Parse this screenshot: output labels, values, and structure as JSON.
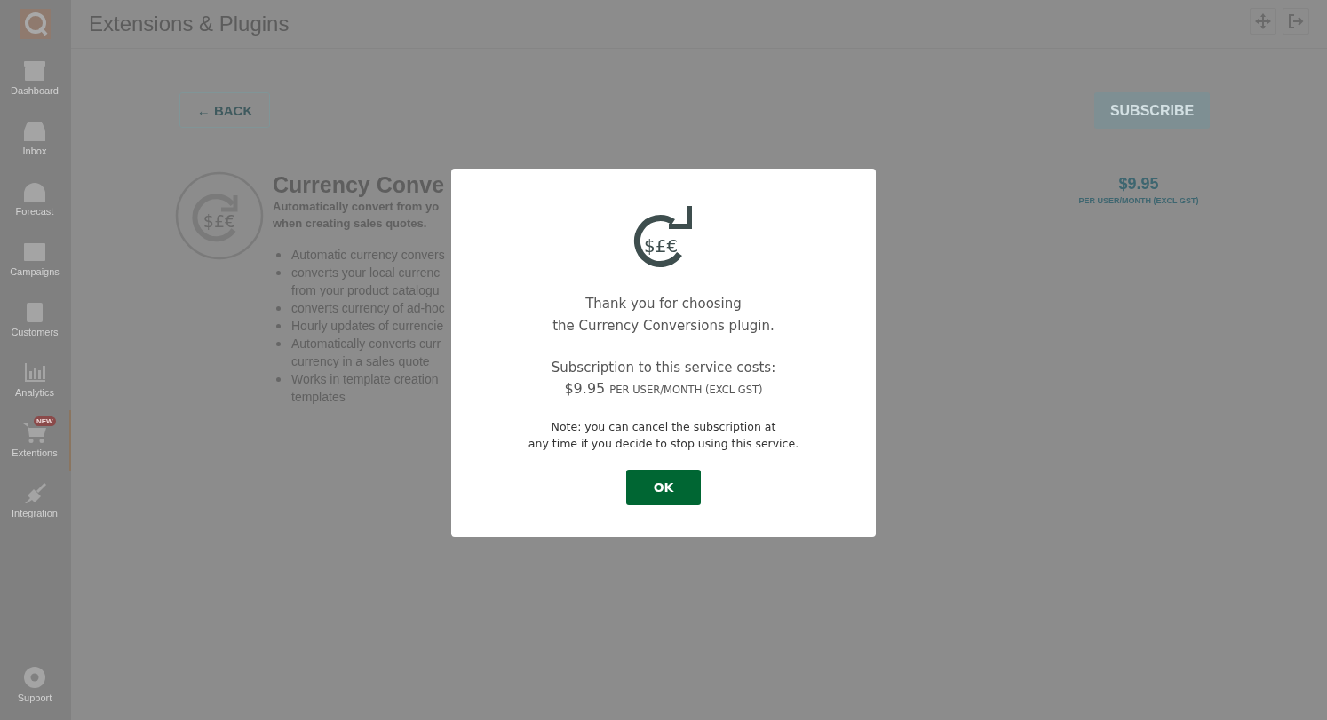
{
  "sidebar": {
    "items": [
      {
        "label": "Dashboard",
        "selected": false
      },
      {
        "label": "Inbox",
        "selected": false
      },
      {
        "label": "Forecast",
        "selected": false
      },
      {
        "label": "Campaigns",
        "selected": false
      },
      {
        "label": "Customers",
        "selected": false
      },
      {
        "label": "Analytics",
        "selected": false
      },
      {
        "label": "Extentions",
        "selected": true,
        "badge": "NEW"
      },
      {
        "label": "Integration",
        "selected": false
      }
    ],
    "footer": {
      "label": "Support"
    }
  },
  "header": {
    "title": "Extensions & Plugins"
  },
  "page": {
    "back_button": "← BACK",
    "subscribe_button": "SUBSCRIBE",
    "plugin": {
      "icon_symbols": "$£€",
      "title": "Currency Conve",
      "description": [
        "Automatically convert from yo",
        "when creating sales quotes."
      ],
      "features": [
        [
          "Automatic currency convers"
        ],
        [
          "converts your local currenc",
          "from your product catalogu"
        ],
        [
          "converts currency of ad-hoc"
        ],
        [
          "Hourly updates of currencie"
        ],
        [
          "Automatically converts curr",
          "currency in a sales quote"
        ],
        [
          "Works in template creation",
          "templates"
        ]
      ]
    },
    "price": "$9.95",
    "price_unit": "PER USER/MONTH (EXCL GST)"
  },
  "dialog": {
    "icon_symbols": "$£€",
    "message": [
      "Thank you for choosing",
      "the Currency Conversions plugin."
    ],
    "cost_label": "Subscription to this service costs:",
    "price": "$9.95",
    "price_unit": "PER USER/MONTH (EXCL GST)",
    "note": [
      "Note: you can cancel the subscription at",
      "any time if you decide to stop using this service."
    ],
    "ok_button": "OK"
  }
}
